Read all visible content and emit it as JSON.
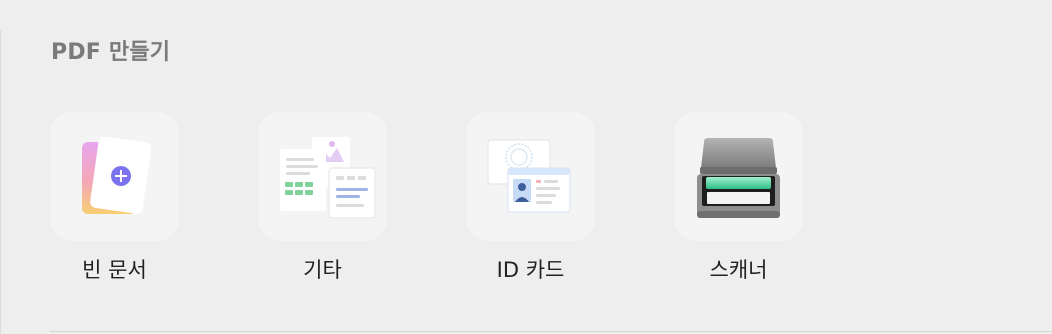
{
  "section": {
    "title": "PDF 만들기"
  },
  "tiles": [
    {
      "label": "빈 문서",
      "icon": "blank-document-icon"
    },
    {
      "label": "기타",
      "icon": "other-documents-icon"
    },
    {
      "label": "ID 카드",
      "icon": "id-card-icon"
    },
    {
      "label": "스캐너",
      "icon": "scanner-icon"
    }
  ],
  "colors": {
    "background": "#efeeef",
    "tile_background": "#f5f4f5",
    "title_text": "#7b7a7b",
    "label_text": "#222222",
    "accent_purple": "#7b72ee",
    "scanner_glow": "#5fe3a8"
  }
}
